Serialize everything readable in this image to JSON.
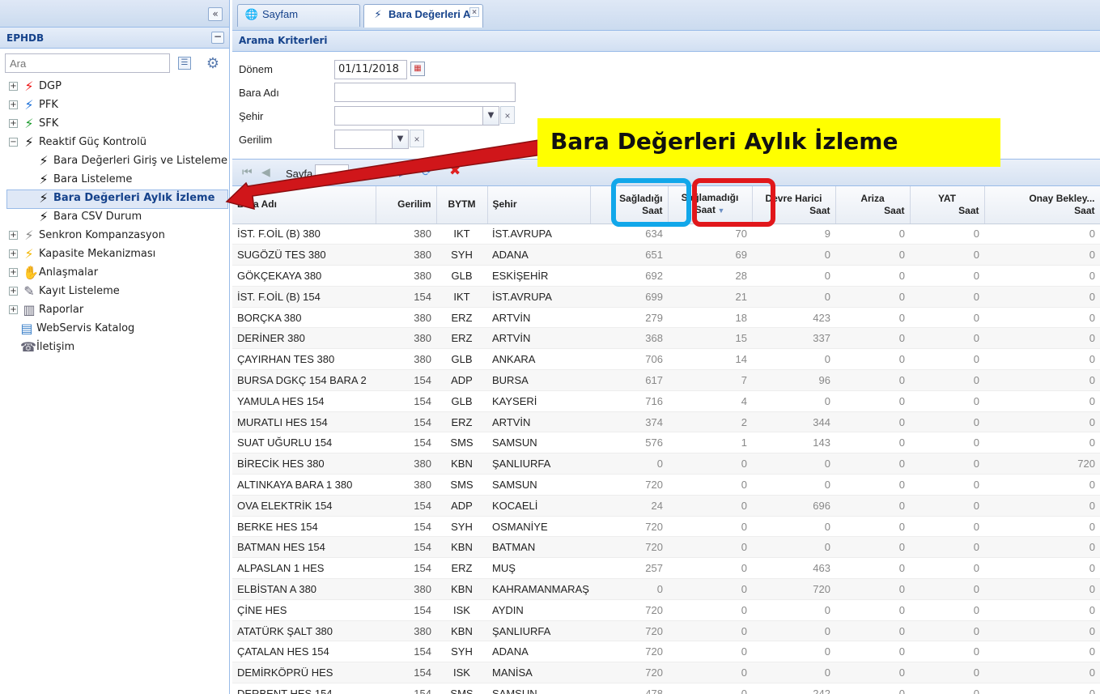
{
  "left": {
    "collapse_glyph": "«",
    "title": "EPHDB",
    "min_glyph": "−",
    "search_placeholder": "Ara",
    "tree": [
      {
        "label": "DGP",
        "expander": "+",
        "icon": "lightning-red-icon",
        "color": "#e11"
      },
      {
        "label": "PFK",
        "expander": "+",
        "icon": "lightning-blue-icon",
        "color": "#1a6ed8"
      },
      {
        "label": "SFK",
        "expander": "+",
        "icon": "lightning-green-icon",
        "color": "#1a9a2c"
      },
      {
        "label": "Reaktif Güç Kontrolü",
        "expander": "−",
        "icon": "lightning-black-icon",
        "color": "#111"
      },
      {
        "label": "Bara Değerleri Giriş ve Listeleme",
        "icon": "lightning-black-icon",
        "color": "#111"
      },
      {
        "label": "Bara Listeleme",
        "icon": "lightning-black-icon",
        "color": "#111"
      },
      {
        "label": "Bara Değerleri Aylık İzleme",
        "icon": "lightning-black-icon",
        "color": "#111",
        "selected": true
      },
      {
        "label": "Bara CSV Durum",
        "icon": "lightning-black-icon",
        "color": "#111"
      },
      {
        "label": "Senkron Kompanzasyon",
        "expander": "+",
        "icon": "lightning-outline-icon",
        "color": "#888"
      },
      {
        "label": "Kapasite Mekanizması",
        "expander": "+",
        "icon": "lightning-yellow-icon",
        "color": "#f2b600"
      },
      {
        "label": "Anlaşmalar",
        "expander": "+",
        "icon": "handshake-icon",
        "color": "#667"
      },
      {
        "label": "Kayıt Listeleme",
        "expander": "+",
        "icon": "edit-document-icon",
        "color": "#667"
      },
      {
        "label": "Raporlar",
        "expander": "+",
        "icon": "chart-icon",
        "color": "#667"
      },
      {
        "label": "WebServis Katalog",
        "icon": "book-icon",
        "color": "#3a7fc8"
      },
      {
        "label": "İletişim",
        "icon": "contact-icon",
        "color": "#667"
      }
    ]
  },
  "tabs": {
    "home": "Sayfam",
    "active": "Bara Değerleri A",
    "close_glyph": "×"
  },
  "criteria": {
    "header": "Arama Kriterleri",
    "donem_label": "Dönem",
    "donem_value": "01/11/2018",
    "bara_label": "Bara Adı",
    "sehir_label": "Şehir",
    "gerilim_label": "Gerilim"
  },
  "toolbar": {
    "page_label": "Sayfa"
  },
  "grid": {
    "columns": [
      {
        "l1": "",
        "l2": "Bara Adı"
      },
      {
        "l1": "",
        "l2": "Gerilim"
      },
      {
        "l1": "",
        "l2": "BYTM"
      },
      {
        "l1": "",
        "l2": "Şehir"
      },
      {
        "l1": "Sağladığı",
        "l2": "Saat"
      },
      {
        "l1": "Sağlamadığı",
        "l2": "Saat"
      },
      {
        "l1": "Devre Harici",
        "l2": "Saat"
      },
      {
        "l1": "Ariza",
        "l2": "Saat"
      },
      {
        "l1": "YAT",
        "l2": "Saat"
      },
      {
        "l1": "Onay Bekley...",
        "l2": "Saat"
      }
    ],
    "rows": [
      [
        "İST. F.OİL (B) 380",
        "380",
        "IKT",
        "İST.AVRUPA",
        "634",
        "70",
        "9",
        "0",
        "0",
        "0"
      ],
      [
        "SUGÖZÜ TES 380",
        "380",
        "SYH",
        "ADANA",
        "651",
        "69",
        "0",
        "0",
        "0",
        "0"
      ],
      [
        "GÖKÇEKAYA 380",
        "380",
        "GLB",
        "ESKİŞEHİR",
        "692",
        "28",
        "0",
        "0",
        "0",
        "0"
      ],
      [
        "İST. F.OİL (B) 154",
        "154",
        "IKT",
        "İST.AVRUPA",
        "699",
        "21",
        "0",
        "0",
        "0",
        "0"
      ],
      [
        "BORÇKA 380",
        "380",
        "ERZ",
        "ARTVİN",
        "279",
        "18",
        "423",
        "0",
        "0",
        "0"
      ],
      [
        "DERİNER 380",
        "380",
        "ERZ",
        "ARTVİN",
        "368",
        "15",
        "337",
        "0",
        "0",
        "0"
      ],
      [
        "ÇAYIRHAN TES 380",
        "380",
        "GLB",
        "ANKARA",
        "706",
        "14",
        "0",
        "0",
        "0",
        "0"
      ],
      [
        "BURSA DGKÇ 154 BARA 2",
        "154",
        "ADP",
        "BURSA",
        "617",
        "7",
        "96",
        "0",
        "0",
        "0"
      ],
      [
        "YAMULA HES 154",
        "154",
        "GLB",
        "KAYSERİ",
        "716",
        "4",
        "0",
        "0",
        "0",
        "0"
      ],
      [
        "MURATLI HES 154",
        "154",
        "ERZ",
        "ARTVİN",
        "374",
        "2",
        "344",
        "0",
        "0",
        "0"
      ],
      [
        "SUAT UĞURLU 154",
        "154",
        "SMS",
        "SAMSUN",
        "576",
        "1",
        "143",
        "0",
        "0",
        "0"
      ],
      [
        "BİRECİK HES 380",
        "380",
        "KBN",
        "ŞANLIURFA",
        "0",
        "0",
        "0",
        "0",
        "0",
        "720"
      ],
      [
        "ALTINKAYA BARA 1 380",
        "380",
        "SMS",
        "SAMSUN",
        "720",
        "0",
        "0",
        "0",
        "0",
        "0"
      ],
      [
        "OVA ELEKTRİK 154",
        "154",
        "ADP",
        "KOCAELİ",
        "24",
        "0",
        "696",
        "0",
        "0",
        "0"
      ],
      [
        "BERKE HES 154",
        "154",
        "SYH",
        "OSMANİYE",
        "720",
        "0",
        "0",
        "0",
        "0",
        "0"
      ],
      [
        "BATMAN HES 154",
        "154",
        "KBN",
        "BATMAN",
        "720",
        "0",
        "0",
        "0",
        "0",
        "0"
      ],
      [
        "ALPASLAN 1 HES",
        "154",
        "ERZ",
        "MUŞ",
        "257",
        "0",
        "463",
        "0",
        "0",
        "0"
      ],
      [
        "ELBİSTAN A 380",
        "380",
        "KBN",
        "KAHRAMANMARAŞ",
        "0",
        "0",
        "720",
        "0",
        "0",
        "0"
      ],
      [
        "ÇİNE HES",
        "154",
        "ISK",
        "AYDIN",
        "720",
        "0",
        "0",
        "0",
        "0",
        "0"
      ],
      [
        "ATATÜRK ŞALT 380",
        "380",
        "KBN",
        "ŞANLIURFA",
        "720",
        "0",
        "0",
        "0",
        "0",
        "0"
      ],
      [
        "ÇATALAN HES 154",
        "154",
        "SYH",
        "ADANA",
        "720",
        "0",
        "0",
        "0",
        "0",
        "0"
      ],
      [
        "DEMİRKÖPRÜ HES",
        "154",
        "ISK",
        "MANİSA",
        "720",
        "0",
        "0",
        "0",
        "0",
        "0"
      ],
      [
        "DERBENT HES 154",
        "154",
        "SMS",
        "SAMSUN",
        "478",
        "0",
        "242",
        "0",
        "0",
        "0"
      ]
    ]
  },
  "annotation": {
    "banner": "Bara Değerleri Aylık İzleme",
    "banner_color": "#ffff00",
    "blue_box_color": "#11a7ea",
    "red_box_color": "#e1171b",
    "arrow_color": "#d0161a"
  }
}
